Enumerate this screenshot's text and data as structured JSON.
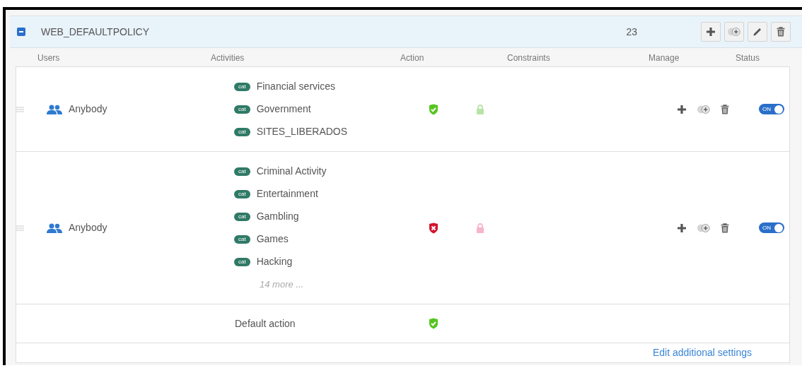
{
  "policy": {
    "name": "WEB_DEFAULTPOLICY",
    "expanded": true,
    "count": "23"
  },
  "columns": [
    "Users",
    "Activities",
    "Action",
    "Constraints",
    "Manage",
    "Status"
  ],
  "rules": [
    {
      "user": "Anybody",
      "activities": [
        {
          "tag": "cat",
          "name": "Financial services"
        },
        {
          "tag": "cat",
          "name": "Government"
        },
        {
          "tag": "cat",
          "name": "SITES_LIBERADOS"
        }
      ],
      "kind": "allow",
      "on": true,
      "status_label": "ON"
    },
    {
      "user": "Anybody",
      "activities": [
        {
          "tag": "cat",
          "name": "Criminal Activity"
        },
        {
          "tag": "cat",
          "name": "Entertainment"
        },
        {
          "tag": "cat",
          "name": "Gambling"
        },
        {
          "tag": "cat",
          "name": "Games"
        },
        {
          "tag": "cat",
          "name": "Hacking"
        }
      ],
      "more": "14 more ...",
      "kind": "block",
      "on": true,
      "status_label": "ON"
    }
  ],
  "default_row": {
    "label": "Default action",
    "kind": "allow"
  },
  "footer_link": "Edit additional settings"
}
